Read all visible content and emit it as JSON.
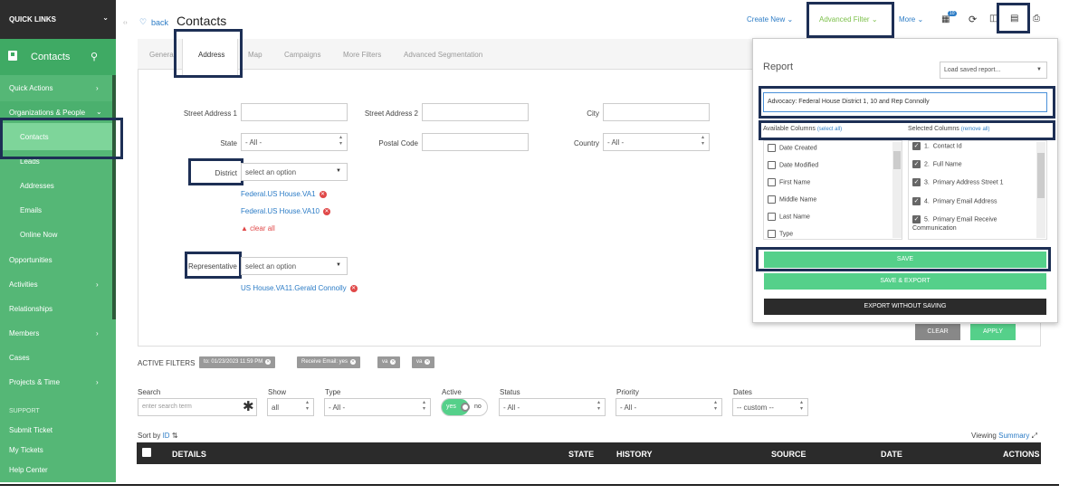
{
  "sidebar": {
    "quick_links": "QUICK LINKS",
    "section_title": "Contacts",
    "items": [
      "Quick Actions",
      "Organizations & People",
      "Contacts",
      "Leads",
      "Addresses",
      "Emails",
      "Online Now",
      "Opportunities",
      "Activities",
      "Relationships",
      "Members",
      "Cases",
      "Projects & Time"
    ],
    "support_heading": "SUPPORT",
    "support_items": [
      "Submit Ticket",
      "My Tickets",
      "Help Center"
    ]
  },
  "header": {
    "back": "back",
    "title": "Contacts",
    "create_new": "Create New",
    "advanced_filter": "Advanced Filter",
    "more": "More",
    "badge": "10"
  },
  "tabs": [
    "General",
    "Address",
    "Map",
    "Campaigns",
    "More Filters",
    "Advanced Segmentation"
  ],
  "form": {
    "street1_label": "Street Address 1",
    "street2_label": "Street Address 2",
    "city_label": "City",
    "state_label": "State",
    "state_value": "- All -",
    "postal_label": "Postal Code",
    "country_label": "Country",
    "country_value": "- All -",
    "district_label": "District",
    "district_placeholder": "select an option",
    "district_tags": [
      "Federal.US House.VA1",
      "Federal.US House.VA10"
    ],
    "clear_all": "clear all",
    "rep_label": "Representative",
    "rep_placeholder": "select an option",
    "rep_tags": [
      "US House.VA11.Gerald Connolly"
    ],
    "clear_btn": "CLEAR",
    "apply_btn": "APPLY"
  },
  "report": {
    "title": "Report",
    "load_saved": "Load saved report...",
    "name_value": "Advocacy: Federal House District 1, 10 and Rep Connolly",
    "available_label": "Available Columns",
    "select_all": "(select all)",
    "selected_label": "Selected Columns",
    "remove_all": "(remove all)",
    "available": [
      "Date Created",
      "Date Modified",
      "First Name",
      "Middle Name",
      "Last Name",
      "Type"
    ],
    "selected": [
      "Contact Id",
      "Full Name",
      "Primary Address Street 1",
      "Primary Email Address",
      "Primary Email Receive Communication"
    ],
    "save": "SAVE",
    "save_export": "SAVE & EXPORT",
    "export_no_save": "EXPORT WITHOUT SAVING"
  },
  "active_filters": {
    "label": "ACTIVE FILTERS",
    "chips": [
      "to: 01/23/2023 11:59 PM",
      "Receive Email: yes",
      "va",
      "va"
    ]
  },
  "list_filters": {
    "search_label": "Search",
    "search_placeholder": "enter search term",
    "show_label": "Show",
    "show_value": "all",
    "type_label": "Type",
    "type_value": "- All -",
    "active_label": "Active",
    "active_yes": "yes",
    "active_no": "no",
    "status_label": "Status",
    "status_value": "- All -",
    "priority_label": "Priority",
    "priority_value": "- All -",
    "dates_label": "Dates",
    "dates_value": "-- custom --"
  },
  "table": {
    "sort_by": "Sort by",
    "sort_field": "ID",
    "viewing": "Viewing",
    "viewing_mode": "Summary",
    "headers": [
      "DETAILS",
      "STATE",
      "HISTORY",
      "SOURCE",
      "DATE",
      "ACTIONS"
    ]
  }
}
